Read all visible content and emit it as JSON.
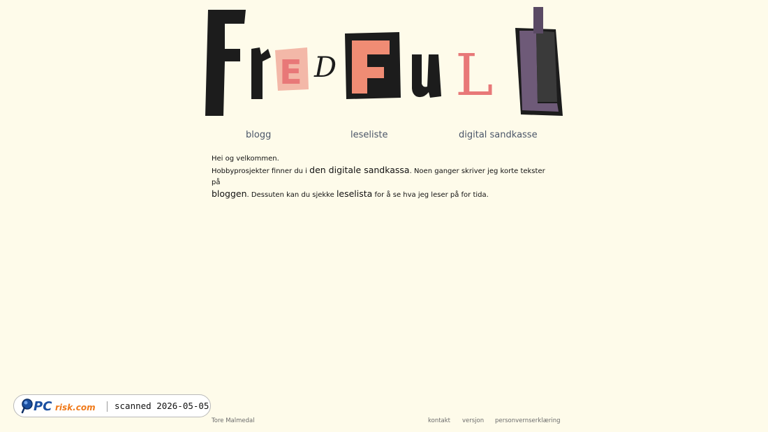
{
  "logo": {
    "alt_text": "FredFull",
    "letters": [
      "F",
      "r",
      "E",
      "D",
      "F",
      "u",
      "L",
      "L"
    ]
  },
  "nav": {
    "items": [
      {
        "label": "blogg"
      },
      {
        "label": "leseliste"
      },
      {
        "label": "digital sandkasse"
      }
    ]
  },
  "intro": {
    "greeting": "Hei og velkommen.",
    "line1_pre": "Hobbyprosjekter finner du i ",
    "link_sandkassa": "den digitale sandkassa",
    "line1_post": ". Noen ganger skriver jeg korte tekster på ",
    "link_bloggen": "bloggen",
    "line2_mid": ". Dessuten kan du sjekke ",
    "link_leselista": "leselista",
    "line2_post": " for å se hva jeg leser på for tida."
  },
  "footer": {
    "author": "Tore Malmedal",
    "links": [
      {
        "label": "kontakt"
      },
      {
        "label": "versjon"
      },
      {
        "label": "personvernserklæring"
      }
    ]
  },
  "badge": {
    "brand": "PCrisk.com",
    "scan_text": "scanned 2026-05-05"
  },
  "colors": {
    "background": "#fefbea",
    "nav_text": "#4a5568",
    "salmon": "#f08c74",
    "pink": "#e87878",
    "dark": "#1c1c1c",
    "purple": "#6e5a78"
  }
}
